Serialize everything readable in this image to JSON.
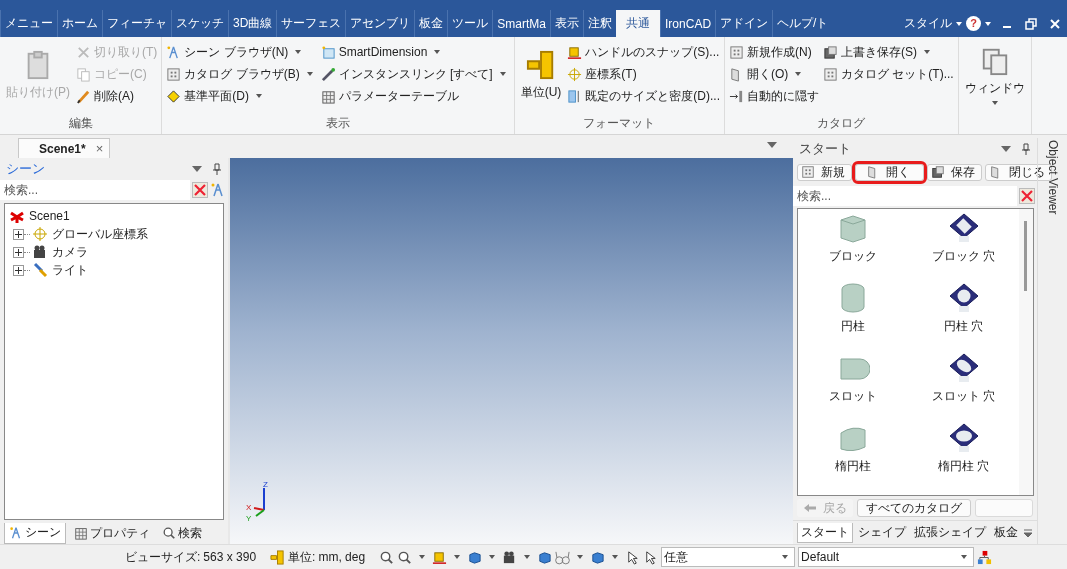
{
  "ribbon_tabs": [
    {
      "label": "メニュー",
      "selected": false
    },
    {
      "label": "ホーム",
      "selected": false
    },
    {
      "label": "フィーチャ",
      "selected": false
    },
    {
      "label": "スケッチ",
      "selected": false
    },
    {
      "label": "3D曲線",
      "selected": false
    },
    {
      "label": "サーフェス",
      "selected": false
    },
    {
      "label": "アセンブリ",
      "selected": false
    },
    {
      "label": "板金",
      "selected": false
    },
    {
      "label": "ツール",
      "selected": false
    },
    {
      "label": "SmartMa",
      "selected": false
    },
    {
      "label": "表示",
      "selected": false
    },
    {
      "label": "注釈",
      "selected": false
    },
    {
      "label": "共通",
      "selected": true
    },
    {
      "label": "IronCAD",
      "selected": false
    },
    {
      "label": "アドイン",
      "selected": false
    },
    {
      "label": "ヘルプ/ト",
      "selected": false
    }
  ],
  "style_menu": {
    "label": "スタイル"
  },
  "help_button": {
    "label": "?"
  },
  "ribbon_groups": [
    {
      "title": "編集",
      "items": [
        {
          "label": "貼り付け(P)",
          "kind": "large",
          "disabled": true,
          "dropdown": false
        },
        {
          "label": "切り取り(T)",
          "kind": "small",
          "disabled": true,
          "dropdown": false
        },
        {
          "label": "コピー(C)",
          "kind": "small",
          "disabled": true,
          "dropdown": false
        },
        {
          "label": "削除(A)",
          "kind": "small",
          "disabled": false,
          "dropdown": false
        }
      ]
    },
    {
      "title": "表示",
      "items": [
        {
          "label": "シーン ブラウザ(N)",
          "kind": "small",
          "disabled": false,
          "dropdown": true
        },
        {
          "label": "カタログ ブラウザ(B)",
          "kind": "small",
          "disabled": false,
          "dropdown": true
        },
        {
          "label": "基準平面(D)",
          "kind": "small",
          "disabled": false,
          "dropdown": true
        },
        {
          "label": "SmartDimension",
          "kind": "small",
          "disabled": false,
          "dropdown": true
        },
        {
          "label": "インスタンスリンク [すべて]",
          "kind": "small",
          "disabled": false,
          "dropdown": true
        },
        {
          "label": "パラメーターテーブル",
          "kind": "small",
          "disabled": false,
          "dropdown": false
        }
      ]
    },
    {
      "title": "フォーマット",
      "items": [
        {
          "label": "単位(U)",
          "kind": "large",
          "disabled": false,
          "dropdown": false
        },
        {
          "label": "ハンドルのスナップ(S)...",
          "kind": "small",
          "disabled": false,
          "dropdown": false
        },
        {
          "label": "座標系(T)",
          "kind": "small",
          "disabled": false,
          "dropdown": false
        },
        {
          "label": "既定のサイズと密度(D)...",
          "kind": "small",
          "disabled": false,
          "dropdown": false
        }
      ]
    },
    {
      "title": "カタログ",
      "items": [
        {
          "label": "新規作成(N)",
          "kind": "small",
          "disabled": false,
          "dropdown": false
        },
        {
          "label": "開く(O)",
          "kind": "small",
          "disabled": false,
          "dropdown": true
        },
        {
          "label": "自動的に隠す",
          "kind": "small",
          "disabled": false,
          "dropdown": false
        },
        {
          "label": "上書き保存(S)",
          "kind": "small",
          "disabled": false,
          "dropdown": true
        },
        {
          "label": "カタログ セット(T)...",
          "kind": "small",
          "disabled": false,
          "dropdown": false
        }
      ]
    },
    {
      "items": [
        {
          "label": "ウィンドウ",
          "kind": "large",
          "disabled": false,
          "dropdown": true
        }
      ]
    }
  ],
  "doc_tabs": [
    {
      "label": "Scene1*",
      "selected": true,
      "close": "×"
    }
  ],
  "scene_panel": {
    "title": "シーン",
    "search": {
      "placeholder": "検索..."
    },
    "tree": [
      {
        "label": "Scene1",
        "children": [
          {
            "label": "グローバル座標系",
            "expanded": false
          },
          {
            "label": "カメラ",
            "expanded": false
          },
          {
            "label": "ライト",
            "expanded": false
          }
        ]
      }
    ],
    "tabs": [
      {
        "label": "シーン",
        "selected": true
      },
      {
        "label": "プロパティ",
        "selected": false
      },
      {
        "label": "検索",
        "selected": false
      }
    ]
  },
  "viewport": {
    "axis_labels": [
      "Z",
      "X",
      "Y"
    ]
  },
  "catalog_panel": {
    "title": "スタート",
    "buttons": [
      {
        "label": "新規",
        "highlighted": false
      },
      {
        "label": "開く",
        "highlighted": true
      },
      {
        "label": "保存",
        "highlighted": false
      },
      {
        "label": "閉じる",
        "highlighted": false
      }
    ],
    "search": {
      "placeholder": "検索..."
    },
    "items": [
      {
        "label": "ブロック",
        "kind": "block",
        "hole": false
      },
      {
        "label": "ブロック 穴",
        "kind": "block",
        "hole": true
      },
      {
        "label": "円柱",
        "kind": "cylinder",
        "hole": false
      },
      {
        "label": "円柱 穴",
        "kind": "cylinder",
        "hole": true
      },
      {
        "label": "スロット",
        "kind": "slot",
        "hole": false
      },
      {
        "label": "スロット 穴",
        "kind": "slot",
        "hole": true
      },
      {
        "label": "楕円柱",
        "kind": "ellipse",
        "hole": false
      },
      {
        "label": "楕円柱 穴",
        "kind": "ellipse",
        "hole": true
      }
    ],
    "back_button": {
      "label": "戻る",
      "disabled": true
    },
    "all_catalogs_button": {
      "label": "すべてのカタログ"
    },
    "tabs": [
      {
        "label": "スタート",
        "selected": true
      },
      {
        "label": "シェイプ",
        "selected": false
      },
      {
        "label": "拡張シェイプ",
        "selected": false
      },
      {
        "label": "板金",
        "selected": false
      }
    ]
  },
  "object_viewer": {
    "label": "Object Viewer"
  },
  "status_bar": {
    "view_size_label": "ビューサイズ:",
    "view_size": "563 x 390",
    "units_label": "単位:",
    "units": "mm, deg",
    "mode_dropdown": "任意",
    "style_dropdown": "Default"
  }
}
